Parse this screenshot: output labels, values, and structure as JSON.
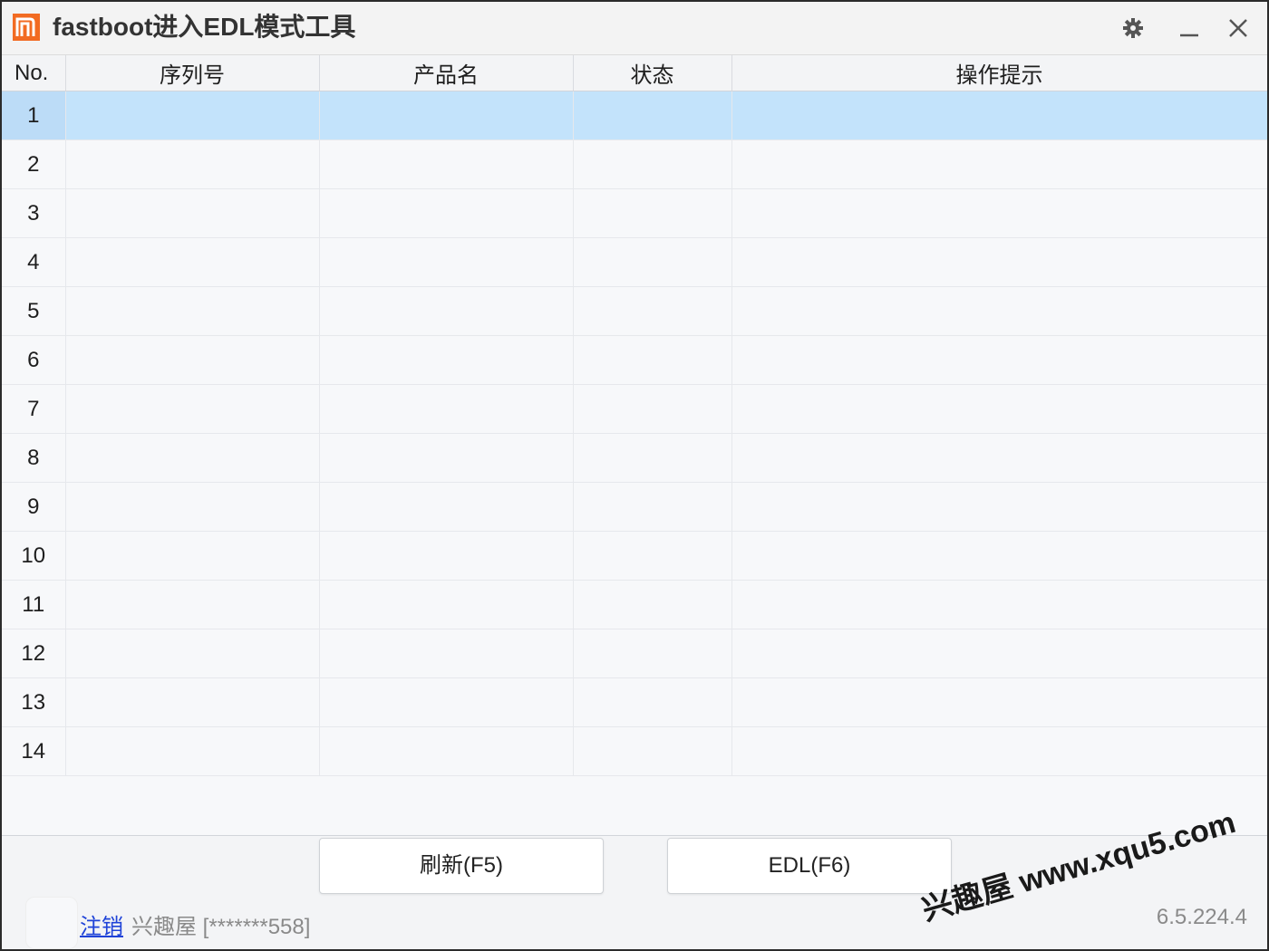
{
  "window": {
    "title": "fastboot进入EDL模式工具",
    "logo_icon": "mi-logo-icon",
    "accent_color": "#f26b22"
  },
  "titlebar_buttons": [
    "gear-icon",
    "minimize-icon",
    "close-icon"
  ],
  "table": {
    "headers": [
      "No.",
      "序列号",
      "产品名",
      "状态",
      "操作提示"
    ],
    "rows": [
      {
        "no": "1",
        "serial": "",
        "product": "",
        "status": "",
        "hint": ""
      },
      {
        "no": "2",
        "serial": "",
        "product": "",
        "status": "",
        "hint": ""
      },
      {
        "no": "3",
        "serial": "",
        "product": "",
        "status": "",
        "hint": ""
      },
      {
        "no": "4",
        "serial": "",
        "product": "",
        "status": "",
        "hint": ""
      },
      {
        "no": "5",
        "serial": "",
        "product": "",
        "status": "",
        "hint": ""
      },
      {
        "no": "6",
        "serial": "",
        "product": "",
        "status": "",
        "hint": ""
      },
      {
        "no": "7",
        "serial": "",
        "product": "",
        "status": "",
        "hint": ""
      },
      {
        "no": "8",
        "serial": "",
        "product": "",
        "status": "",
        "hint": ""
      },
      {
        "no": "9",
        "serial": "",
        "product": "",
        "status": "",
        "hint": ""
      },
      {
        "no": "10",
        "serial": "",
        "product": "",
        "status": "",
        "hint": ""
      },
      {
        "no": "11",
        "serial": "",
        "product": "",
        "status": "",
        "hint": ""
      },
      {
        "no": "12",
        "serial": "",
        "product": "",
        "status": "",
        "hint": ""
      },
      {
        "no": "13",
        "serial": "",
        "product": "",
        "status": "",
        "hint": ""
      },
      {
        "no": "14",
        "serial": "",
        "product": "",
        "status": "",
        "hint": ""
      }
    ],
    "selected_row": 1,
    "selected_color": "#c3e3fb"
  },
  "actions": {
    "refresh_label": "刷新(F5)",
    "edl_label": "EDL(F6)"
  },
  "footer": {
    "logout_label": "注销",
    "account_text": "兴趣屋 [*******558]",
    "version": "6.5.224.4"
  },
  "watermark": "兴趣屋 www.xqu5.com"
}
